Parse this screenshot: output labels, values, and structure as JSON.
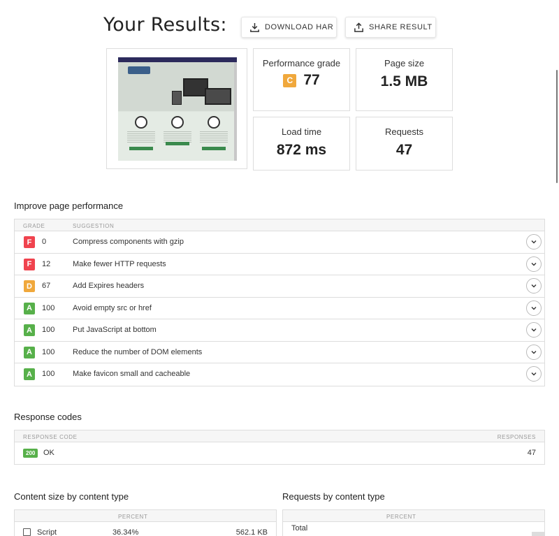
{
  "header": {
    "title": "Your Results:",
    "download_label": "DOWNLOAD HAR",
    "share_label": "SHARE RESULT"
  },
  "metrics": {
    "performance_label": "Performance grade",
    "performance_grade": "C",
    "performance_score": "77",
    "page_size_label": "Page size",
    "page_size_value": "1.5 MB",
    "load_time_label": "Load time",
    "load_time_value": "872 ms",
    "requests_label": "Requests",
    "requests_value": "47"
  },
  "improve": {
    "title": "Improve page performance",
    "col_grade": "GRADE",
    "col_suggestion": "SUGGESTION",
    "rows": [
      {
        "grade": "F",
        "score": "0",
        "suggestion": "Compress components with gzip"
      },
      {
        "grade": "F",
        "score": "12",
        "suggestion": "Make fewer HTTP requests"
      },
      {
        "grade": "D",
        "score": "67",
        "suggestion": "Add Expires headers"
      },
      {
        "grade": "A",
        "score": "100",
        "suggestion": "Avoid empty src or href"
      },
      {
        "grade": "A",
        "score": "100",
        "suggestion": "Put JavaScript at bottom"
      },
      {
        "grade": "A",
        "score": "100",
        "suggestion": "Reduce the number of DOM elements"
      },
      {
        "grade": "A",
        "score": "100",
        "suggestion": "Make favicon small and cacheable"
      }
    ]
  },
  "codes": {
    "title": "Response codes",
    "col_code": "RESPONSE CODE",
    "col_responses": "RESPONSES",
    "rows": [
      {
        "code": "200",
        "text": "OK",
        "count": "47"
      }
    ]
  },
  "content_size": {
    "title": "Content size by content type",
    "col_percent": "PERCENT",
    "rows": [
      {
        "type": "Script",
        "percent": "36.34%",
        "size": "562.1 KB"
      }
    ]
  },
  "requests_by_type": {
    "title": "Requests by content type",
    "col_percent": "PERCENT",
    "total_label": "Total"
  },
  "colors": {
    "grade_F": "#f0434e",
    "grade_D": "#f0a83c",
    "grade_C": "#f0a83c",
    "grade_A": "#57b04a"
  }
}
